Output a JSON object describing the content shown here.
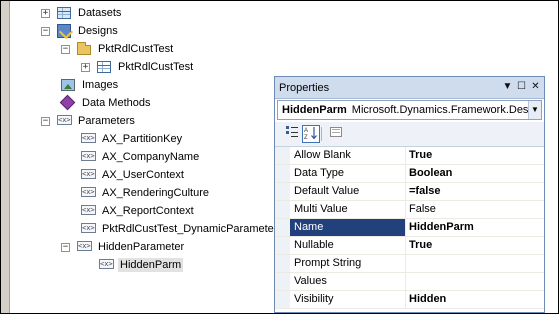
{
  "tree": {
    "nodes": [
      {
        "label": "Datasets",
        "expander": "+",
        "icon": "datasets-icon"
      },
      {
        "label": "Designs",
        "expander": "−",
        "icon": "designs-icon"
      },
      {
        "label": "PktRdlCustTest",
        "expander": "−",
        "icon": "folder-icon"
      },
      {
        "label": "PktRdlCustTest",
        "expander": "+",
        "icon": "report-table-icon"
      },
      {
        "label": "Images",
        "expander": "",
        "icon": "images-icon"
      },
      {
        "label": "Data Methods",
        "expander": "",
        "icon": "data-methods-icon"
      },
      {
        "label": "Parameters",
        "expander": "−",
        "icon": "parameters-icon"
      },
      {
        "label": "AX_PartitionKey",
        "expander": "",
        "icon": "parameter-icon"
      },
      {
        "label": "AX_CompanyName",
        "expander": "",
        "icon": "parameter-icon"
      },
      {
        "label": "AX_UserContext",
        "expander": "",
        "icon": "parameter-icon"
      },
      {
        "label": "AX_RenderingCulture",
        "expander": "",
        "icon": "parameter-icon"
      },
      {
        "label": "AX_ReportContext",
        "expander": "",
        "icon": "parameter-icon"
      },
      {
        "label": "PktRdlCustTest_DynamicParameter",
        "expander": "",
        "icon": "parameter-icon"
      },
      {
        "label": "HiddenParameter",
        "expander": "−",
        "icon": "parameter-icon"
      },
      {
        "label": "HiddenParm",
        "expander": "",
        "icon": "parameter-icon"
      }
    ]
  },
  "properties": {
    "title": "Properties",
    "pin_glyph": "▼",
    "pin2_glyph": "☐",
    "close_glyph": "✕",
    "object_name": "HiddenParm",
    "object_type": "Microsoft.Dynamics.Framework.Des",
    "toolbar": {
      "categorized_icon": "categorized-icon",
      "alphabetical_icon": "alphabetical-icon",
      "property-pages_icon": "property-pages-icon"
    },
    "rows": [
      {
        "name": "Allow Blank",
        "value": "True",
        "bold": true
      },
      {
        "name": "Data Type",
        "value": "Boolean",
        "bold": true
      },
      {
        "name": "Default Value",
        "value": "=false",
        "bold": true
      },
      {
        "name": "Multi Value",
        "value": "False",
        "bold": false
      },
      {
        "name": "Name",
        "value": "HiddenParm",
        "bold": true
      },
      {
        "name": "Nullable",
        "value": "True",
        "bold": true
      },
      {
        "name": "Prompt String",
        "value": "",
        "bold": false
      },
      {
        "name": "Values",
        "value": "",
        "bold": false
      },
      {
        "name": "Visibility",
        "value": "Hidden",
        "bold": true
      }
    ]
  }
}
